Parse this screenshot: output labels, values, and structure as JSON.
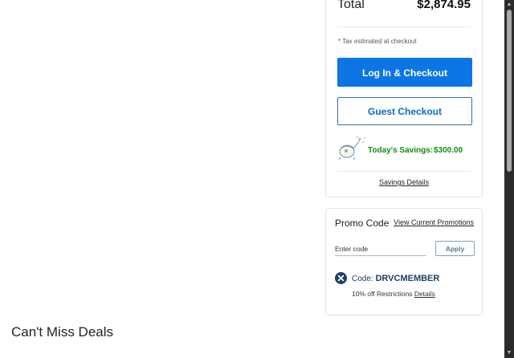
{
  "summary": {
    "total_label": "Total",
    "total_value": "$2,874.95",
    "tax_note": "* Tax estimated at checkout",
    "login_checkout_label": "Log In & Checkout",
    "guest_checkout_label": "Guest Checkout",
    "savings_label": "Today's Savings:",
    "savings_value": "$300.00",
    "savings_details_label": "Savings Details",
    "accent_color": "#0c75e6",
    "savings_color": "#138a14"
  },
  "promo": {
    "title": "Promo Code",
    "promotions_link": "View Current Promotions",
    "input_placeholder": "Enter code",
    "apply_label": "Apply",
    "code_prefix": "Code:",
    "code_value": "DRVCMEMBER",
    "restriction_text": "10% off Restrictions",
    "details_link": "Details",
    "remove_icon": "close-circle-icon"
  },
  "deals": {
    "heading": "Can't Miss Deals"
  }
}
